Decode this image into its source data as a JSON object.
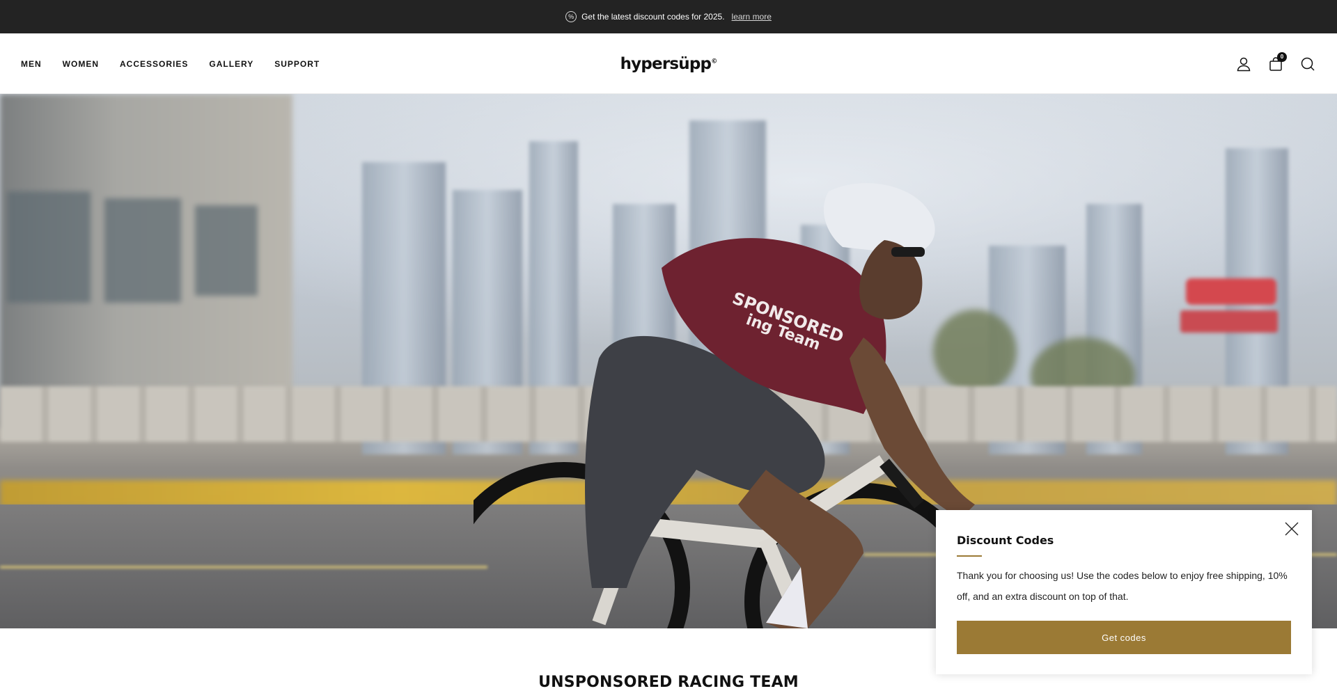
{
  "announcement": {
    "icon": "percent-icon",
    "text": "Get the latest discount codes for 2025.",
    "link_label": "learn more"
  },
  "header": {
    "nav": [
      "MEN",
      "WOMEN",
      "ACCESSORIES",
      "GALLERY",
      "SUPPORT"
    ],
    "logo": "hypersüpp",
    "logo_mark": "©",
    "cart_count": "0",
    "icons": [
      "account-icon",
      "cart-icon",
      "search-icon"
    ]
  },
  "hero": {
    "slides_total": 5,
    "active_slide": 2
  },
  "section": {
    "title": "UNSPONSORED RACING TEAM"
  },
  "popup": {
    "title": "Discount Codes",
    "body": "Thank you for choosing us! Use the codes below to enjoy free shipping, 10% off, and an extra discount on top of that.",
    "button_label": "Get codes"
  },
  "colors": {
    "announce_bg": "#232323",
    "accent": "#9b7a35"
  }
}
